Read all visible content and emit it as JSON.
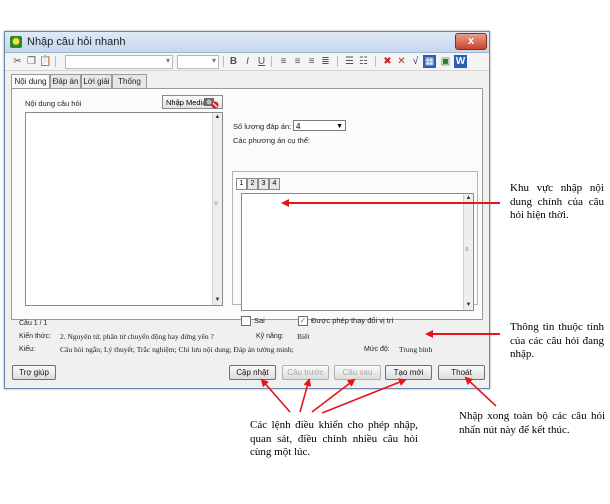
{
  "window": {
    "title": "Nhập câu hỏi nhanh",
    "close_label": "x"
  },
  "tabs": [
    {
      "label": "Nội dung"
    },
    {
      "label": "Đáp án"
    },
    {
      "label": "Lời giải"
    },
    {
      "label": "Thống kê"
    }
  ],
  "toolbar": {
    "icons": [
      "cut-icon",
      "copy-icon",
      "paste-icon",
      "font-combo",
      "size-combo",
      "bold-icon",
      "italic-icon",
      "underline-icon",
      "align-left-icon",
      "align-center-icon",
      "align-right-icon",
      "justify-icon",
      "numbered-list-icon",
      "bullet-list-icon",
      "symbol-icon",
      "formula-icon",
      "sqrt-icon",
      "table-icon",
      "image-icon",
      "word-icon"
    ],
    "bold": "B",
    "italic": "I",
    "underline": "U"
  },
  "content": {
    "question_label": "Nội dung câu hỏi",
    "media_button": "Nhập Media",
    "answer_count_label": "Số lượng đáp án:",
    "answer_count_value": "4",
    "options_label": "Các phương án cụ thể:",
    "option_tabs": [
      "1",
      "2",
      "3",
      "4"
    ],
    "wrong_label": "Sai",
    "allow_reorder_label": "Được phép thay đổi vị trí",
    "allow_reorder_checked": true
  },
  "info": {
    "counter": "Câu 1 / 1",
    "knowledge_label": "Kiến thức:",
    "knowledge_value": "2. Nguyên tử, phân tử chuyển động hay đứng yên ?",
    "skill_label": "Kỹ năng:",
    "skill_value": "Biết",
    "type_label": "Kiểu:",
    "type_value": "Câu hỏi ngắn; Lý thuyết; Trắc nghiệm; Chỉ lưu nội dung; Đáp án tường minh;",
    "level_label": "Mức độ:",
    "level_value": "Trung bình"
  },
  "buttons": {
    "help": "Trợ giúp",
    "update": "Cập nhật",
    "previous": "Câu trước",
    "next": "Câu sau",
    "new": "Tạo mới",
    "exit": "Thoát"
  },
  "annotations": {
    "content_area": "Khu vực nhập nội dung chính của câu hỏi hiện thời.",
    "info_area": "Thông tin thuộc tính của các câu hỏi đang nhập.",
    "controls": "Các lệnh điều khiển cho phép nhập, quan sát, điều chỉnh nhiều câu hỏi cùng một lúc.",
    "exit": "Nhập xong toàn bộ các câu hỏi nhấn nút này để kết thúc."
  },
  "colors": {
    "arrow": "#e8141c",
    "window_border": "#6d87a8"
  }
}
